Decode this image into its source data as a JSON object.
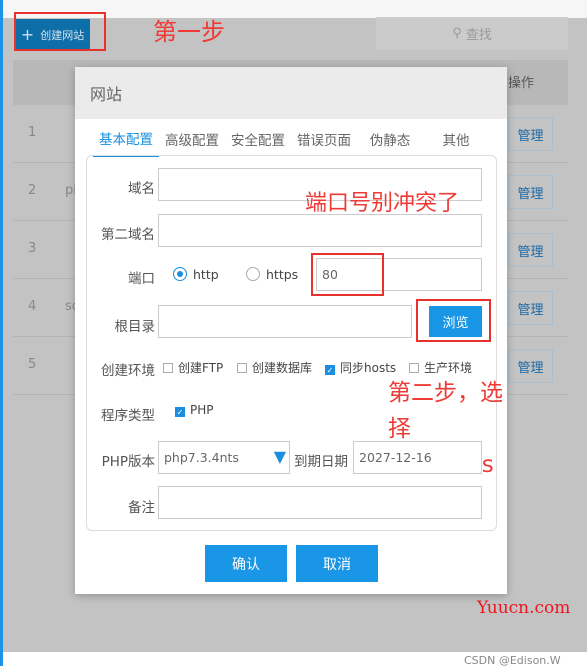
{
  "toolbar": {
    "create_label": "创建网站",
    "search_label": "查找"
  },
  "annotations": {
    "step1": "第一步",
    "port_note": "端口号别冲突了",
    "step2_line1": "第二步，选择",
    "step2_line2": "bluelutos"
  },
  "table": {
    "header_action": "操作",
    "rows": [
      {
        "num": "1",
        "name": "",
        "action": "管理"
      },
      {
        "num": "2",
        "name": "pi",
        "action": "管理"
      },
      {
        "num": "3",
        "name": "",
        "action": "管理"
      },
      {
        "num": "4",
        "name": "sc",
        "action": "管理"
      },
      {
        "num": "5",
        "name": "",
        "action": "管理"
      }
    ]
  },
  "modal": {
    "title": "网站",
    "tabs": [
      "基本配置",
      "高级配置",
      "安全配置",
      "错误页面",
      "伪静态",
      "其他"
    ],
    "active_tab": "基本配置",
    "form": {
      "domain_label": "域名",
      "domain_value": "",
      "second_domain_label": "第二域名",
      "second_domain_value": "",
      "port_label": "端口",
      "http_label": "http",
      "https_label": "https",
      "protocol_selected": "http",
      "port_value": "80",
      "root_label": "根目录",
      "root_value": "",
      "browse_label": "浏览",
      "env_label": "创建环境",
      "env_options": [
        {
          "label": "创建FTP",
          "checked": false
        },
        {
          "label": "创建数据库",
          "checked": false
        },
        {
          "label": "同步hosts",
          "checked": true
        },
        {
          "label": "生产环境",
          "checked": false
        }
      ],
      "program_label": "程序类型",
      "program_option": {
        "label": "PHP",
        "checked": true
      },
      "php_label": "PHP版本",
      "php_value": "php7.3.4nts",
      "expire_label": "到期日期",
      "expire_value": "2027-12-16",
      "note_label": "备注",
      "note_value": ""
    },
    "confirm_label": "确认",
    "cancel_label": "取消"
  },
  "watermarks": {
    "site": "Yuucn.com",
    "csdn": "CSDN @Edison.W"
  },
  "colors": {
    "accent": "#1a96e6",
    "annotation": "#f03a36"
  }
}
